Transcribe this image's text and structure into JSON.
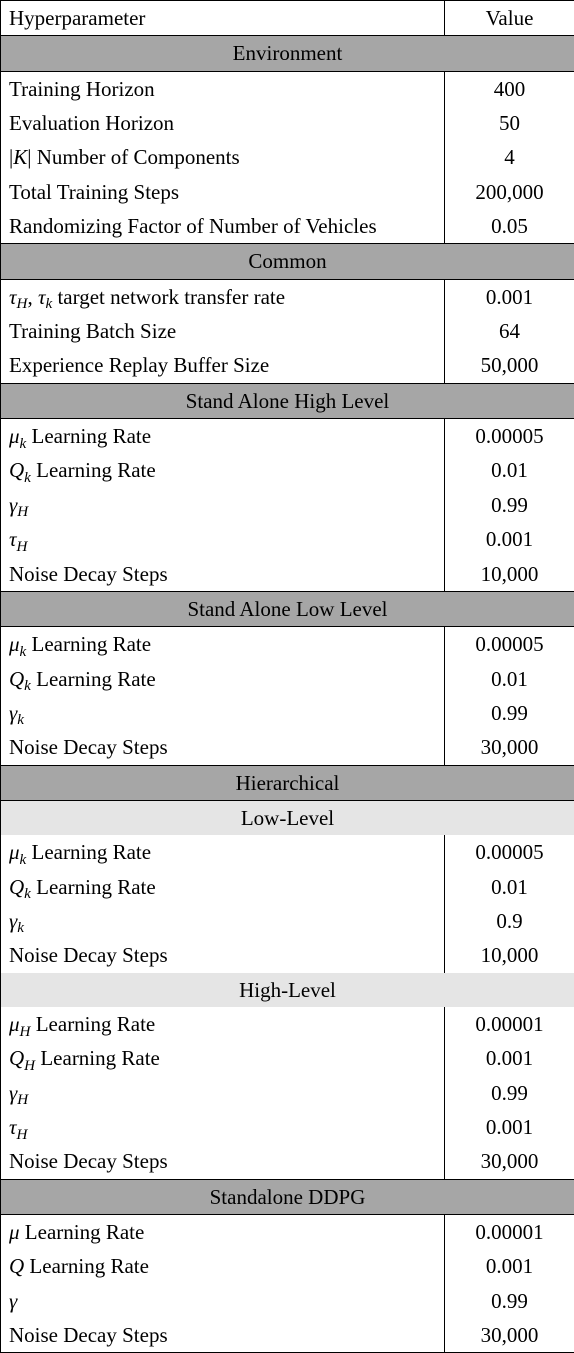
{
  "header": {
    "param": "Hyperparameter",
    "value": "Value"
  },
  "sections": [
    {
      "title": "Environment",
      "rows": [
        {
          "label_html": "Training Horizon",
          "value": "400"
        },
        {
          "label_html": "Evaluation Horizon",
          "value": "50"
        },
        {
          "label_html": "|<span class='it'>K</span>| Number of Components",
          "value": "4"
        },
        {
          "label_html": "Total Training Steps",
          "value": "200,000"
        },
        {
          "label_html": "Randomizing Factor of Number of Vehicles",
          "value": "0.05"
        }
      ]
    },
    {
      "title": "Common",
      "rows": [
        {
          "label_html": "<span class='it'>τ</span><span class='sub'>H</span>, <span class='it'>τ</span><span class='sub'>k</span> target network transfer rate",
          "value": "0.001"
        },
        {
          "label_html": "Training Batch Size",
          "value": "64"
        },
        {
          "label_html": "Experience Replay Buffer Size",
          "value": "50,000"
        }
      ]
    },
    {
      "title": "Stand Alone High Level",
      "rows": [
        {
          "label_html": "<span class='it'>μ</span><span class='sub'>k</span> Learning Rate",
          "value": "0.00005"
        },
        {
          "label_html": "<span class='it'>Q</span><span class='sub'>k</span> Learning Rate",
          "value": "0.01"
        },
        {
          "label_html": "<span class='it'>γ</span><span class='sub'>H</span>",
          "value": "0.99"
        },
        {
          "label_html": "<span class='it'>τ</span><span class='sub'>H</span>",
          "value": "0.001"
        },
        {
          "label_html": "Noise Decay Steps",
          "value": "10,000"
        }
      ]
    },
    {
      "title": "Stand Alone Low Level",
      "rows": [
        {
          "label_html": "<span class='it'>μ</span><span class='sub'>k</span> Learning Rate",
          "value": "0.00005"
        },
        {
          "label_html": "<span class='it'>Q</span><span class='sub'>k</span> Learning Rate",
          "value": "0.01"
        },
        {
          "label_html": "<span class='it'>γ</span><span class='sub'>k</span>",
          "value": "0.99"
        },
        {
          "label_html": "Noise Decay Steps",
          "value": "30,000"
        }
      ]
    },
    {
      "title": "Hierarchical",
      "subsections": [
        {
          "title": "Low-Level",
          "rows": [
            {
              "label_html": "<span class='it'>μ</span><span class='sub'>k</span> Learning Rate",
              "value": "0.00005"
            },
            {
              "label_html": "<span class='it'>Q</span><span class='sub'>k</span> Learning Rate",
              "value": "0.01"
            },
            {
              "label_html": "<span class='it'>γ</span><span class='sub'>k</span>",
              "value": "0.9"
            },
            {
              "label_html": "Noise Decay Steps",
              "value": "10,000"
            }
          ]
        },
        {
          "title": "High-Level",
          "rows": [
            {
              "label_html": "<span class='it'>μ</span><span class='sub'>H</span> Learning Rate",
              "value": "0.00001"
            },
            {
              "label_html": "<span class='it'>Q</span><span class='sub'>H</span> Learning Rate",
              "value": "0.001"
            },
            {
              "label_html": "<span class='it'>γ</span><span class='sub'>H</span>",
              "value": "0.99"
            },
            {
              "label_html": "<span class='it'>τ</span><span class='sub'>H</span>",
              "value": "0.001"
            },
            {
              "label_html": "Noise Decay Steps",
              "value": "30,000"
            }
          ]
        }
      ]
    },
    {
      "title": "Standalone DDPG",
      "rows": [
        {
          "label_html": "<span class='it'>μ</span> Learning Rate",
          "value": "0.00001"
        },
        {
          "label_html": "<span class='it'>Q</span> Learning Rate",
          "value": "0.001"
        },
        {
          "label_html": "<span class='it'>γ</span>",
          "value": "0.99"
        },
        {
          "label_html": "Noise Decay Steps",
          "value": "30,000"
        }
      ]
    }
  ]
}
